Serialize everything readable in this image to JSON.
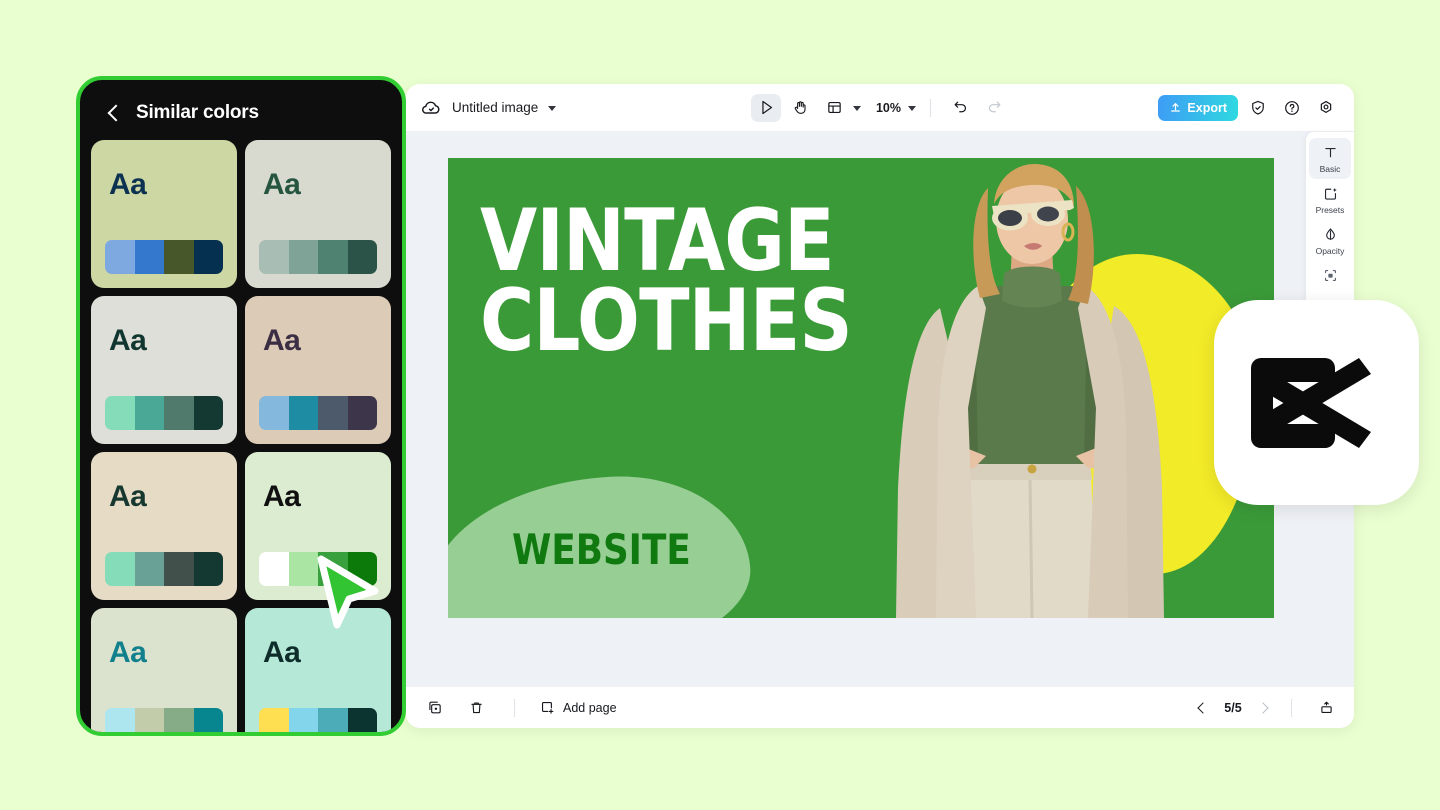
{
  "background_color": "#eaffd0",
  "panel": {
    "title": "Similar colors",
    "back_icon": "chevron-left-icon",
    "border_color": "#32cd32",
    "background_color": "#0e0e0e",
    "cards": [
      {
        "sample_text": "Aa",
        "bg": "#ccd7a3",
        "text_color": "#0d3150",
        "swatches": [
          "#7da9e0",
          "#3478ce",
          "#47572a",
          "#06304f"
        ]
      },
      {
        "sample_text": "Aa",
        "bg": "#d8d9cf",
        "text_color": "#25543f",
        "swatches": [
          "#a8bdb4",
          "#7fa396",
          "#4f8270",
          "#2c5347"
        ]
      },
      {
        "sample_text": "Aa",
        "bg": "#dedfd9",
        "text_color": "#11362f",
        "swatches": [
          "#84dcb9",
          "#4aa996",
          "#4f7a6c",
          "#143832"
        ]
      },
      {
        "sample_text": "Aa",
        "bg": "#dccbb6",
        "text_color": "#3b2e44",
        "swatches": [
          "#84b8dc",
          "#1e8ca3",
          "#4c5a6c",
          "#3d3549"
        ]
      },
      {
        "sample_text": "Aa",
        "bg": "#e6dcc6",
        "text_color": "#16382f",
        "swatches": [
          "#84dcb9",
          "#6aa197",
          "#41504b",
          "#143832"
        ]
      },
      {
        "sample_text": "Aa",
        "bg": "#dcecd0",
        "text_color": "#101010",
        "swatches": [
          "#ffffff",
          "#aae5a3",
          "#38a03c",
          "#0b7a0b"
        ]
      },
      {
        "sample_text": "Aa",
        "bg": "#dbe3cf",
        "text_color": "#11808c",
        "swatches": [
          "#aee6f0",
          "#c2ccaa",
          "#85ab87",
          "#07868f"
        ]
      },
      {
        "sample_text": "Aa",
        "bg": "#b6e8d8",
        "text_color": "#0e2d2a",
        "swatches": [
          "#ffdf52",
          "#82d5ea",
          "#4cacb8",
          "#0b332f"
        ]
      }
    ]
  },
  "editor": {
    "topbar": {
      "cloud_icon": "cloud-sync-icon",
      "doc_title": "Untitled image",
      "title_caret_icon": "chevron-down-icon",
      "select_tool_icon": "cursor-arrow-icon",
      "hand_tool_icon": "hand-pan-icon",
      "layout_tool_icon": "layout-grid-icon",
      "layout_caret_icon": "chevron-down-icon",
      "zoom_level": "10%",
      "zoom_caret_icon": "chevron-down-icon",
      "undo_icon": "undo-arrow-icon",
      "redo_icon": "redo-arrow-icon",
      "export_label": "Export",
      "export_icon": "upload-icon",
      "export_gradient_from": "#3e9cf5",
      "export_gradient_to": "#2fd9e0",
      "shield_icon": "shield-check-icon",
      "help_icon": "question-circle-icon",
      "settings_icon": "gear-icon"
    },
    "right_rail": [
      {
        "label": "Basic",
        "icon": "text-T-icon",
        "active": true
      },
      {
        "label": "Presets",
        "icon": "presets-sparkle-icon",
        "active": false
      },
      {
        "label": "Opacity",
        "icon": "opacity-droplet-icon",
        "active": false
      },
      {
        "label": "",
        "icon": "crop-frame-icon",
        "active": false
      }
    ],
    "artboard": {
      "background_color": "#3b9a38",
      "headline": "VINTAGE\nCLOTHES",
      "headline_color": "#ffffff",
      "subhead": "WEBSITE",
      "subhead_color": "#107a10",
      "blob_color": "#96ce94",
      "accent_yellow": "#f2eb28"
    },
    "bottombar": {
      "duplicate_icon": "duplicate-page-icon",
      "delete_icon": "trash-icon",
      "add_page_icon": "add-page-icon",
      "add_page_label": "Add page",
      "prev_icon": "chevron-left-icon",
      "page_indicator": "5/5",
      "next_icon": "chevron-right-icon",
      "present_icon": "present-export-icon"
    }
  },
  "logo": {
    "name": "capcut-logo",
    "color": "#000000",
    "background": "#ffffff"
  },
  "cursor": {
    "name": "pointer-cursor",
    "fill": "#33c434",
    "stroke": "#ffffff"
  }
}
